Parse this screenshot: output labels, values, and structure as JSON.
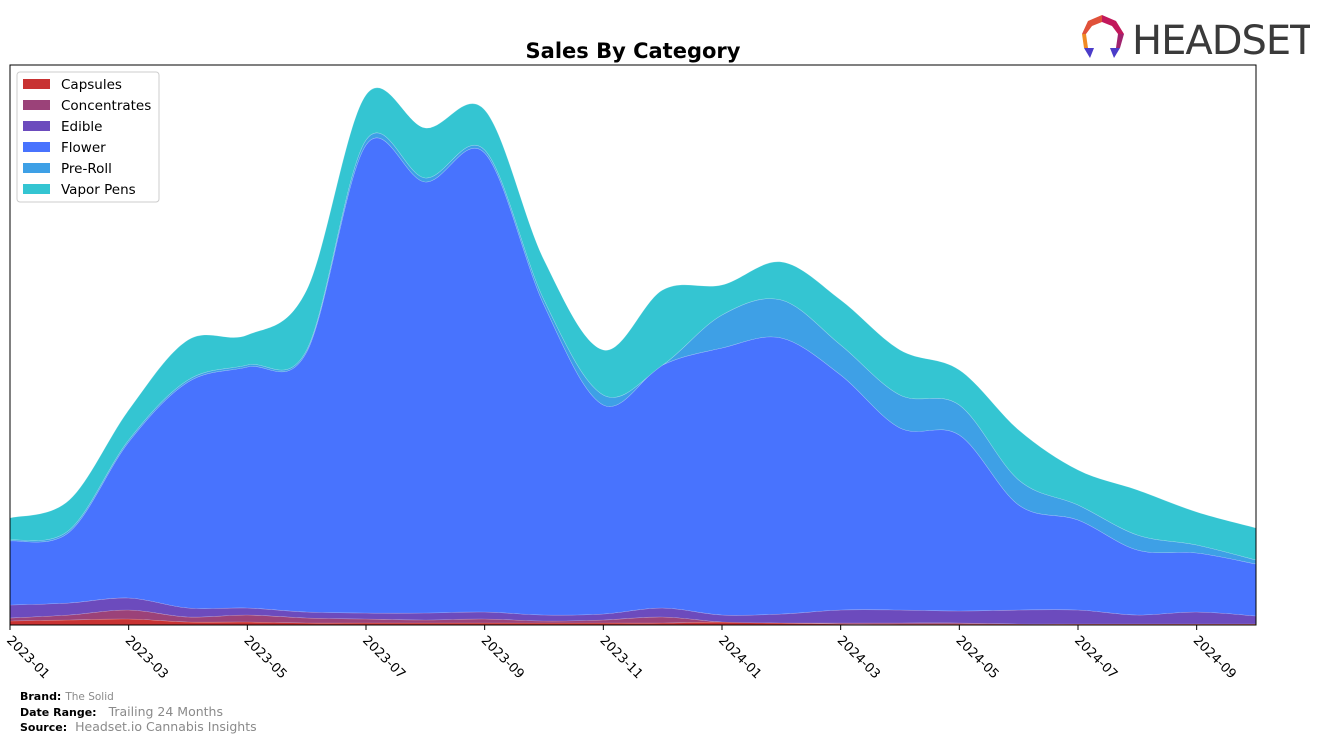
{
  "logo": {
    "text": "HEADSET",
    "icon": "headset-logo-icon"
  },
  "footer": {
    "brand_label": "Brand:",
    "brand_value": "The Solid",
    "range_label": "Date Range:",
    "range_value": "Trailing 24 Months",
    "source_label": "Source:",
    "source_value": "Headset.io Cannabis Insights"
  },
  "chart_data": {
    "type": "area",
    "stacked": true,
    "smoothed": true,
    "title": "Sales By Category",
    "xlabel": "",
    "ylabel": "",
    "y_axis_visible": false,
    "grid": false,
    "legend_position": "top-left",
    "x": [
      "2023-01",
      "2023-02",
      "2023-03",
      "2023-04",
      "2023-05",
      "2023-06",
      "2023-07",
      "2023-08",
      "2023-09",
      "2023-10",
      "2023-11",
      "2023-12",
      "2024-01",
      "2024-02",
      "2024-03",
      "2024-04",
      "2024-05",
      "2024-06",
      "2024-07",
      "2024-08",
      "2024-09",
      "2024-10"
    ],
    "x_tick_labels": [
      "2023-01",
      "2023-03",
      "2023-05",
      "2023-07",
      "2023-09",
      "2023-11",
      "2024-01",
      "2024-03",
      "2024-05",
      "2024-07",
      "2024-09"
    ],
    "ylim": [
      0,
      560
    ],
    "series": [
      {
        "name": "Capsules",
        "color": "#c83232",
        "values": [
          4,
          5,
          6,
          3,
          3,
          2,
          2,
          2,
          2,
          2,
          2,
          2,
          3,
          2,
          1,
          1,
          1,
          1,
          1,
          1,
          1,
          1
        ]
      },
      {
        "name": "Concentrates",
        "color": "#9b4279",
        "values": [
          3,
          5,
          9,
          5,
          7,
          5,
          4,
          3,
          4,
          2,
          3,
          6,
          0,
          0,
          1,
          1,
          1,
          0,
          0,
          0,
          0,
          0
        ]
      },
      {
        "name": "Edible",
        "color": "#6c4bbd",
        "values": [
          13,
          12,
          12,
          9,
          7,
          6,
          6,
          7,
          7,
          6,
          6,
          9,
          7,
          9,
          13,
          13,
          12,
          14,
          14,
          9,
          12,
          8
        ]
      },
      {
        "name": "Flower",
        "color": "#4873fe",
        "values": [
          64,
          71,
          156,
          226,
          241,
          260,
          468,
          431,
          459,
          310,
          209,
          243,
          267,
          276,
          235,
          182,
          176,
          105,
          90,
          65,
          59,
          52
        ]
      },
      {
        "name": "Pre-Roll",
        "color": "#3ea0e6",
        "values": [
          1,
          2,
          2,
          2,
          2,
          2,
          5,
          4,
          3,
          5,
          10,
          0,
          33,
          38,
          30,
          33,
          30,
          25,
          15,
          15,
          8,
          4
        ]
      },
      {
        "name": "Vapor Pens",
        "color": "#34c5d2",
        "values": [
          22,
          30,
          30,
          40,
          30,
          60,
          45,
          50,
          40,
          40,
          45,
          75,
          30,
          38,
          45,
          45,
          35,
          50,
          35,
          45,
          33,
          32
        ]
      }
    ]
  }
}
